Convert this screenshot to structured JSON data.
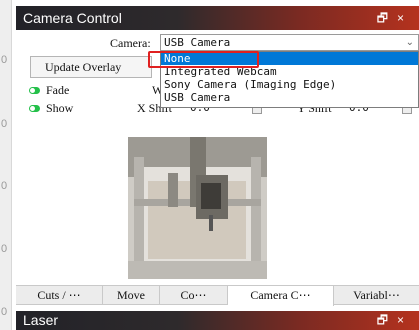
{
  "left_ruler": {
    "labels": [
      "0",
      "0",
      "0",
      "0",
      "0"
    ]
  },
  "window": {
    "title": "Camera Control",
    "icons": [
      "restore-icon",
      "close-icon"
    ],
    "restore_glyph": "🗗",
    "close_glyph": "×"
  },
  "camera": {
    "label": "Camera:",
    "selected": "USB Camera",
    "options": [
      "None",
      "Integrated Webcam",
      "Sony Camera (Imaging Edge)",
      "USB Camera"
    ],
    "highlighted_option": "None"
  },
  "controls": {
    "update_overlay_label": "Update Overlay",
    "w_label": "W",
    "fade_label": "Fade",
    "fade_on": true,
    "show_label": "Show",
    "show_on": true,
    "x_shift_label": "X Shift",
    "x_shift_value": "0.0",
    "y_shift_label": "Y Shift",
    "y_shift_value": "0.0"
  },
  "tabs": [
    {
      "label": "Cuts / ⋯",
      "active": false
    },
    {
      "label": "Move",
      "active": false
    },
    {
      "label": "Co⋯",
      "active": false
    },
    {
      "label": "Camera C⋯",
      "active": true
    },
    {
      "label": "Variabl⋯",
      "active": false
    }
  ],
  "next_panel": {
    "title": "Laser"
  },
  "colors": {
    "title_bar_start": "#222228",
    "title_bar_end": "#b5321e",
    "selection": "#0078d7",
    "annotation_box": "#e02020",
    "toggle_on": "#24c04a"
  }
}
